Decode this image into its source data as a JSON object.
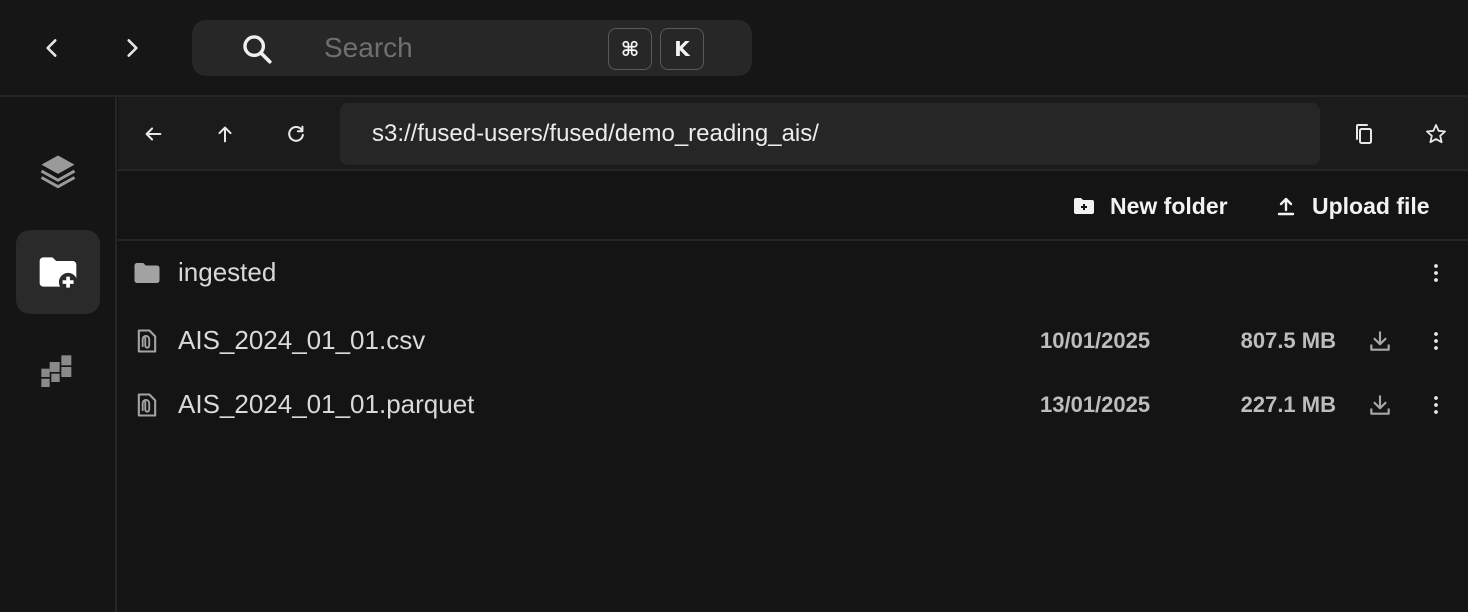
{
  "search": {
    "placeholder": "Search",
    "shortcut_key_1": "⌘",
    "shortcut_key_2": "K"
  },
  "pathbar": {
    "path": "s3://fused-users/fused/demo_reading_ais/"
  },
  "actions": {
    "new_folder": "New folder",
    "upload_file": "Upload file"
  },
  "files": [
    {
      "name": "ingested",
      "type": "folder",
      "date": "",
      "size": ""
    },
    {
      "name": "AIS_2024_01_01.csv",
      "type": "file",
      "date": "10/01/2025",
      "size": "807.5 MB"
    },
    {
      "name": "AIS_2024_01_01.parquet",
      "type": "file",
      "date": "13/01/2025",
      "size": "227.1 MB"
    }
  ],
  "colors": {
    "background": "#141414",
    "panel": "#262626",
    "text": "#e8e8e8",
    "muted": "#bdbdbd"
  }
}
